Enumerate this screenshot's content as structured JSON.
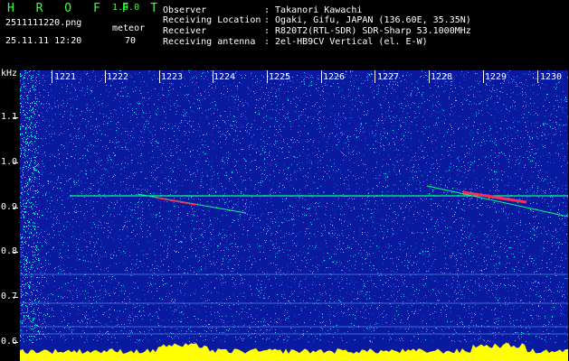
{
  "app": {
    "logo": "H R O F F T",
    "version": "1.0.0"
  },
  "file": {
    "name": "2511111220.png",
    "datetime": "25.11.11 12:20",
    "type_label": "meteor",
    "count": "70"
  },
  "station": {
    "observer_label": "Observer",
    "observer_value": ": Takanori Kawachi",
    "location_label": "Receiving Location",
    "location_value": ": Ogaki, Gifu, JAPAN (136.60E, 35.35N)",
    "receiver_label": "Receiver",
    "receiver_value": ": R820T2(RTL-SDR) SDR-Sharp 53.1000MHz",
    "antenna_label": "Receiving antenna",
    "antenna_value": ": 2el-HB9CV Vertical (el. E-W)"
  },
  "axis": {
    "y_unit": "kHz",
    "y_ticks": [
      "1.1",
      "1.0",
      "0.9",
      "0.8",
      "0.7",
      "0.6"
    ],
    "x_ticks": [
      "1221",
      "1222",
      "1223",
      "1224",
      "1225",
      "1226",
      "1227",
      "1228",
      "1229",
      "1230"
    ]
  },
  "colors": {
    "background": "#0a1aa0",
    "noise_light": "#3aa0ff",
    "noise_cyan": "#00ffff",
    "trace": "#00ff80",
    "echo": "#ff2a5a",
    "baseline": "#ffff00"
  }
}
